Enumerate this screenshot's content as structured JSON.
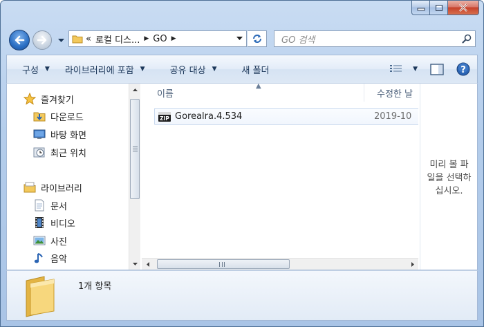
{
  "window": {
    "controls": {
      "minimize": "minimize-icon",
      "maximize": "maximize-icon",
      "close": "close-icon"
    }
  },
  "nav": {
    "back_icon": "back-arrow-icon",
    "forward_icon": "forward-arrow-icon",
    "address": {
      "prefix": "«",
      "crumbs": [
        "로컬 디스...",
        "GO"
      ]
    },
    "search": {
      "placeholder": "GO 검색"
    }
  },
  "toolbar": {
    "organize": "구성",
    "include_library": "라이브러리에 포함",
    "share_with": "공유 대상",
    "new_folder": "새 폴더"
  },
  "sidebar": {
    "favorites": {
      "label": "즐겨찾기",
      "items": [
        {
          "label": "다운로드",
          "icon": "downloads-folder-icon"
        },
        {
          "label": "바탕 화면",
          "icon": "desktop-icon"
        },
        {
          "label": "최근 위치",
          "icon": "recent-places-icon"
        }
      ]
    },
    "libraries": {
      "label": "라이브러리",
      "items": [
        {
          "label": "문서",
          "icon": "documents-icon"
        },
        {
          "label": "비디오",
          "icon": "videos-icon"
        },
        {
          "label": "사진",
          "icon": "pictures-icon"
        },
        {
          "label": "음악",
          "icon": "music-icon"
        }
      ]
    }
  },
  "file_list": {
    "columns": {
      "name": "이름",
      "modified": "수정한 날"
    },
    "rows": [
      {
        "name": "Gorealra.4.534",
        "modified": "2019-10",
        "icon": "zip-file-icon"
      }
    ]
  },
  "preview": {
    "lines": [
      "미리 볼 파",
      "일을 선택하",
      "십시오."
    ]
  },
  "details": {
    "count": "1개 항목"
  },
  "colors": {
    "accent": "#1e395b",
    "chrome": "#b4cdeb",
    "selection_border": "#c9d9ee",
    "folder": "#f3c95c"
  }
}
